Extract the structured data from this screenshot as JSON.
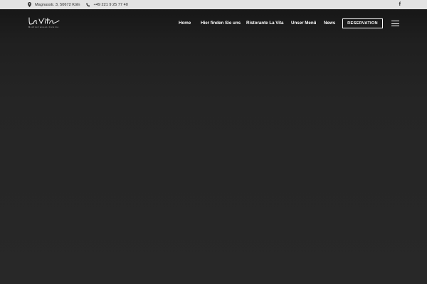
{
  "topbar": {
    "address": "Magnusstr. 3, 50672 Köln",
    "phone": "+49 221 9 25 77 40",
    "social_icon": "facebook-icon"
  },
  "logo": {
    "wordmark": "La Vita",
    "tagline": "Mediterranean Cuisine"
  },
  "nav": {
    "items": [
      {
        "label": "Home"
      },
      {
        "label": "Hier finden Sie uns"
      },
      {
        "label": "Ristorante La Vita"
      },
      {
        "label": "Unser Menü"
      },
      {
        "label": "News"
      }
    ],
    "reserve_label": "RESERVATION",
    "menu_icon": "hamburger-menu-icon"
  },
  "colors": {
    "topbar_bg": "#e3e3e3",
    "header_bg": "#1c1c1c",
    "hero_bg": "#282828",
    "text_light": "#ffffff"
  }
}
